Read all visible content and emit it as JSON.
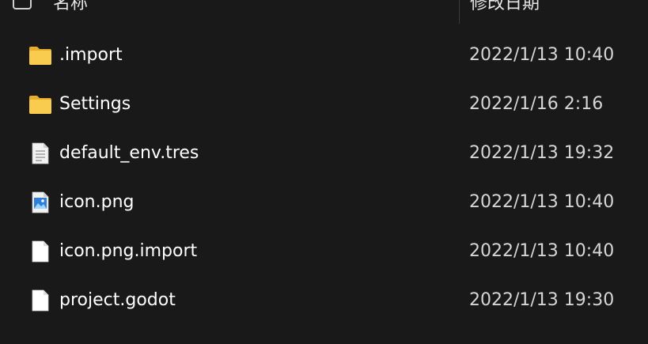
{
  "header": {
    "name_label": "名称",
    "date_label": "修改日期"
  },
  "files": [
    {
      "name": ".import",
      "date": "2022/1/13 10:40",
      "icon": "folder-icon"
    },
    {
      "name": "Settings",
      "date": "2022/1/16 2:16",
      "icon": "folder-icon"
    },
    {
      "name": "default_env.tres",
      "date": "2022/1/13 19:32",
      "icon": "text-file-icon"
    },
    {
      "name": "icon.png",
      "date": "2022/1/13 10:40",
      "icon": "image-file-icon"
    },
    {
      "name": "icon.png.import",
      "date": "2022/1/13 10:40",
      "icon": "file-icon"
    },
    {
      "name": "project.godot",
      "date": "2022/1/13 19:30",
      "icon": "file-icon"
    }
  ],
  "colors": {
    "background": "#191919",
    "folder": "#f8c84a",
    "text": "#ffffff"
  }
}
